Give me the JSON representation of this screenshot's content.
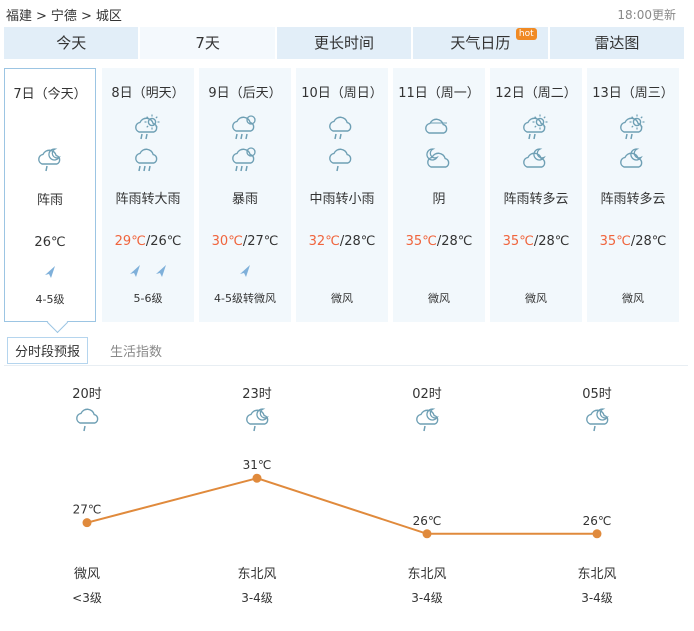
{
  "breadcrumb": [
    "福建",
    "宁德",
    "城区"
  ],
  "breadcrumb_sep": ">",
  "updated": "18:00更新",
  "tabs": [
    {
      "label": "今天",
      "active": false
    },
    {
      "label": "7天",
      "active": true
    },
    {
      "label": "更长时间",
      "active": false
    },
    {
      "label": "天气日历",
      "active": false,
      "badge": "hot"
    },
    {
      "label": "雷达图",
      "active": false
    }
  ],
  "days": [
    {
      "date": "7日（今天）",
      "icons": [
        "shower-rain-night-icon"
      ],
      "weather": "阵雨",
      "high": "",
      "low": "26℃",
      "wind_arrows": 1,
      "wind": "4-5级",
      "active": true
    },
    {
      "date": "8日（明天）",
      "icons": [
        "shower-rain-day-icon",
        "heavy-rain-icon"
      ],
      "weather": "阵雨转大雨",
      "high": "29℃",
      "low": "/26℃",
      "wind_arrows": 2,
      "wind": "5-6级",
      "active": false
    },
    {
      "date": "9日（后天）",
      "icons": [
        "rainstorm-icon",
        "rainstorm-icon"
      ],
      "weather": "暴雨",
      "high": "30℃",
      "low": "/27℃",
      "wind_arrows": 1,
      "wind": "4-5级转微风",
      "active": false
    },
    {
      "date": "10日（周日）",
      "icons": [
        "moderate-rain-icon",
        "light-rain-icon"
      ],
      "weather": "中雨转小雨",
      "high": "32℃",
      "low": "/28℃",
      "wind_arrows": 0,
      "wind": "微风",
      "active": false
    },
    {
      "date": "11日（周一）",
      "icons": [
        "overcast-icon",
        "overcast-night-icon"
      ],
      "weather": "阴",
      "high": "35℃",
      "low": "/28℃",
      "wind_arrows": 0,
      "wind": "微风",
      "active": false
    },
    {
      "date": "12日（周二）",
      "icons": [
        "shower-rain-day-icon",
        "partly-cloudy-night-icon"
      ],
      "weather": "阵雨转多云",
      "high": "35℃",
      "low": "/28℃",
      "wind_arrows": 0,
      "wind": "微风",
      "active": false
    },
    {
      "date": "13日（周三）",
      "icons": [
        "shower-rain-day-icon",
        "partly-cloudy-night-icon"
      ],
      "weather": "阵雨转多云",
      "high": "35℃",
      "low": "/28℃",
      "wind_arrows": 0,
      "wind": "微风",
      "active": false
    }
  ],
  "subtabs": [
    {
      "label": "分时段预报",
      "active": true
    },
    {
      "label": "生活指数",
      "active": false
    }
  ],
  "hourly": [
    {
      "time": "20时",
      "icon": "light-rain-icon",
      "temp": 27,
      "temp_label": "27℃",
      "wind": "微风",
      "level": "<3级"
    },
    {
      "time": "23时",
      "icon": "shower-rain-night-icon",
      "temp": 31,
      "temp_label": "31℃",
      "wind": "东北风",
      "level": "3-4级"
    },
    {
      "time": "02时",
      "icon": "shower-rain-night-icon",
      "temp": 26,
      "temp_label": "26℃",
      "wind": "东北风",
      "level": "3-4级"
    },
    {
      "time": "05时",
      "icon": "shower-rain-night-icon",
      "temp": 26,
      "temp_label": "26℃",
      "wind": "东北风",
      "level": "3-4级"
    }
  ],
  "colors": {
    "accent": "#e08a3c",
    "tab_bg": "#e2eef8",
    "high_temp": "#f0643c",
    "icon": "#6e9fb4"
  }
}
